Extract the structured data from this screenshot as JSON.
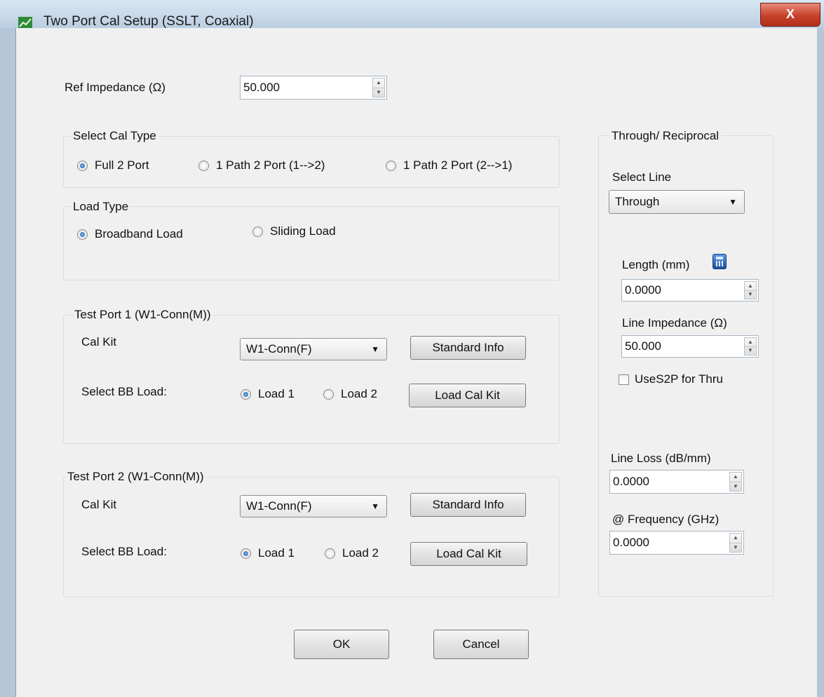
{
  "window": {
    "title": "Two Port Cal Setup (SSLT, Coaxial)",
    "close_label": "X",
    "app_icon": "app-icon",
    "accent": "#c7412a"
  },
  "ref_impedance": {
    "label": "Ref Impedance (Ω)",
    "value": "50.000"
  },
  "cal_type": {
    "legend": "Select Cal Type",
    "options": [
      "Full 2 Port",
      "1 Path 2 Port (1-->2)",
      "1 Path 2 Port (2-->1)"
    ],
    "selected": 0
  },
  "load_type": {
    "legend": "Load Type",
    "options": [
      "Broadband Load",
      "Sliding Load"
    ],
    "selected": 0
  },
  "port1": {
    "legend": "Test Port 1 (W1-Conn(M))",
    "cal_kit_label": "Cal Kit",
    "cal_kit_value": "W1-Conn(F)",
    "standard_info": "Standard Info",
    "bb_load_label": "Select BB Load:",
    "load1": "Load 1",
    "load2": "Load 2",
    "load_cal_kit": "Load Cal Kit"
  },
  "port2": {
    "legend": "Test Port 2 (W1-Conn(M))",
    "cal_kit_label": "Cal Kit",
    "cal_kit_value": "W1-Conn(F)",
    "standard_info": "Standard Info",
    "bb_load_label": "Select BB Load:",
    "load1": "Load 1",
    "load2": "Load 2",
    "load_cal_kit": "Load Cal Kit"
  },
  "through": {
    "legend": "Through/ Reciprocal",
    "select_line_label": "Select Line",
    "select_line_value": "Through",
    "length_label": "Length (mm)",
    "length_value": "0.0000",
    "line_impedance_label": "Line Impedance (Ω)",
    "line_impedance_value": "50.000",
    "use_s2p_label": "UseS2P for Thru",
    "use_s2p_checked": false,
    "line_loss_label": "Line Loss (dB/mm)",
    "line_loss_value": "0.0000",
    "frequency_label": "@ Frequency (GHz)",
    "frequency_value": "0.0000"
  },
  "buttons": {
    "ok": "OK",
    "cancel": "Cancel"
  }
}
